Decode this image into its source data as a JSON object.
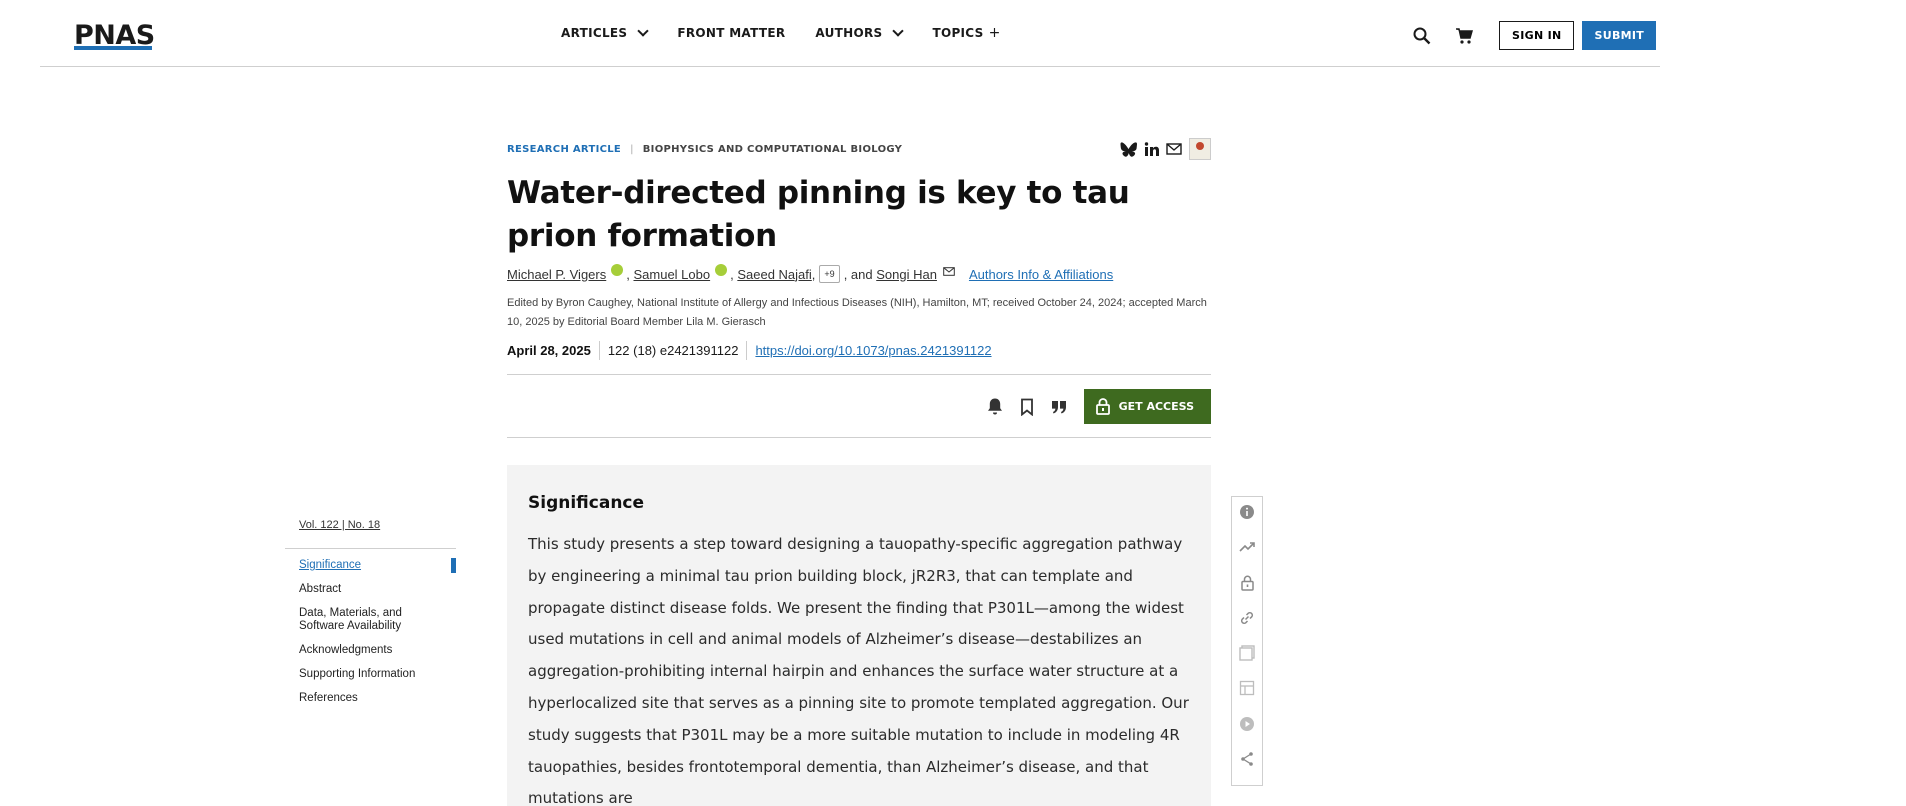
{
  "header": {
    "logo_text": "PNAS",
    "nav": [
      {
        "label": "ARTICLES",
        "has_dropdown": true
      },
      {
        "label": "FRONT MATTER",
        "has_dropdown": false
      },
      {
        "label": "AUTHORS",
        "has_dropdown": true
      },
      {
        "label": "TOPICS",
        "suffix": "+"
      }
    ],
    "sign_in_label": "SIGN IN",
    "submit_label": "SUBMIT",
    "icons": [
      "search-icon",
      "cart-icon"
    ]
  },
  "article": {
    "type": "RESEARCH ARTICLE",
    "type_separator": "|",
    "subject": "BIOPHYSICS AND COMPUTATIONAL BIOLOGY",
    "share_icons": [
      "bluesky-icon",
      "linkedin-icon",
      "email-icon",
      "journal-cover-icon"
    ],
    "title": "Water-directed pinning is key to tau prion formation",
    "authors": {
      "a1": "Michael P. Vigers",
      "a2": "Samuel Lobo",
      "a3": "Saeed Najafi",
      "more": "+9",
      "and_text": ", and",
      "a4": "Songi Han",
      "affiliations_link": "Authors Info & Affiliations"
    },
    "edited_by": "Edited by Byron Caughey, National Institute of Allergy and Infectious Diseases (NIH), Hamilton, MT; received October 24, 2024; accepted March 10, 2025 by Editorial Board Member Lila M. Gierasch",
    "date": "April 28, 2025",
    "citation": "122 (18) e2421391122",
    "doi": "https://doi.org/10.1073/pnas.2421391122",
    "toolbar": {
      "icons": [
        "bell-icon",
        "bookmark-icon",
        "quote-icon"
      ],
      "get_access_label": "GET ACCESS",
      "accent_color": "#3e6a1f"
    }
  },
  "significance": {
    "heading": "Significance",
    "text": "This study presents a step toward designing a tauopathy-specific aggregation pathway by engineering a minimal tau prion building block, jR2R3, that can template and propagate distinct disease folds. We present the finding that P301L—among the widest used mutations in cell and animal models of Alzheimer’s disease—destabilizes an aggregation-prohibiting internal hairpin and enhances the surface water structure at a hyperlocalized site that serves as a pinning site to promote templated aggregation. Our study suggests that P301L may be a more suitable mutation to include in modeling 4R tauopathies, besides frontotemporal dementia, than Alzheimer’s disease, and that mutations are"
  },
  "toc": {
    "volume": "Vol. 122 | No. 18",
    "items": [
      {
        "label": "Significance",
        "active": true
      },
      {
        "label": "Abstract"
      },
      {
        "label": "Data, Materials, and Software Availability"
      },
      {
        "label": "Acknowledgments"
      },
      {
        "label": "Supporting Information"
      },
      {
        "label": "References"
      }
    ]
  },
  "rail": {
    "icons": [
      "info-icon",
      "metrics-icon",
      "lock-icon",
      "link-icon",
      "figures-icon",
      "tables-icon",
      "media-icon",
      "share-icon"
    ]
  },
  "colors": {
    "brand_blue": "#1f6fb5",
    "access_green": "#3e6a1f",
    "orcid_green": "#a6ce39",
    "significance_bg": "#f3f3f3"
  }
}
